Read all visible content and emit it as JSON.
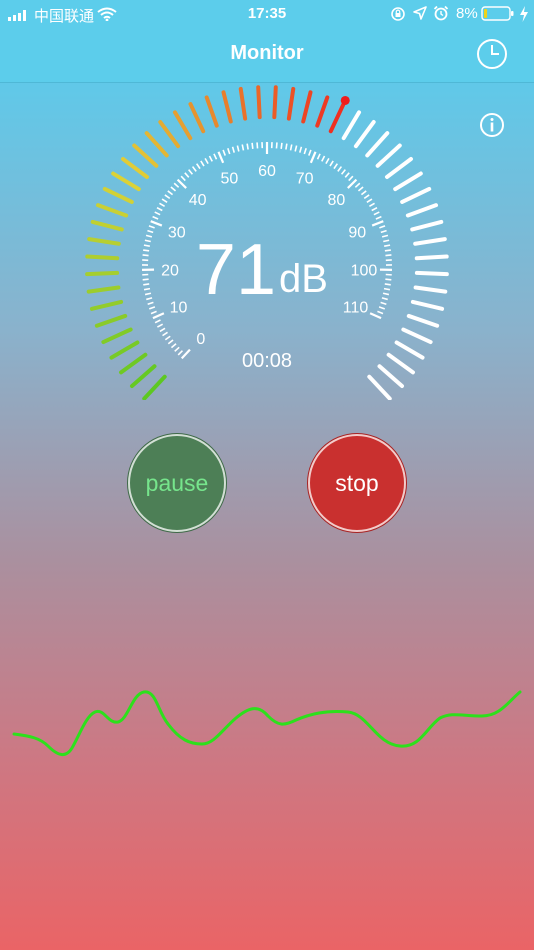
{
  "status_bar": {
    "carrier": "中国联通",
    "time": "17:35",
    "battery_percent": "8%",
    "battery_level": 0.08,
    "icons": [
      "signal-icon",
      "wifi-icon",
      "rotation-lock-icon",
      "location-icon",
      "alarm-icon",
      "battery-icon",
      "charging-icon"
    ]
  },
  "nav": {
    "title": "Monitor",
    "history_icon": "clock-icon",
    "info_icon": "info-icon"
  },
  "gauge": {
    "reading_value": "71",
    "reading_unit": "dB",
    "level": 71,
    "max": 120,
    "timer": "00:08",
    "scale_labels": [
      "0",
      "10",
      "20",
      "30",
      "40",
      "50",
      "60",
      "70",
      "80",
      "90",
      "100",
      "110"
    ],
    "colors": {
      "low": "#5dc821",
      "mid": "#e0d238",
      "high": "#ef2f21",
      "inactive": "#ffffff",
      "needle_dot": "#f01c1c"
    }
  },
  "controls": {
    "pause_label": "pause",
    "stop_label": "stop",
    "pause_color": "#4d7f56",
    "stop_color": "#c9302f"
  },
  "waveform": {
    "color": "#2de01c"
  }
}
